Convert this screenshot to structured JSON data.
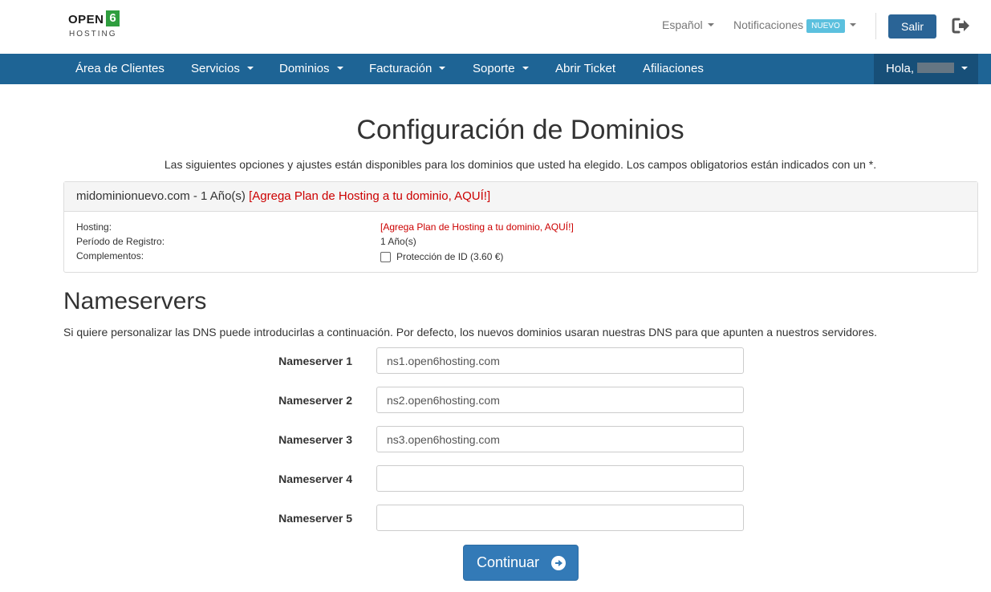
{
  "header": {
    "logo": {
      "top": "OPEN",
      "digit": "6",
      "bottom": "HOSTING"
    },
    "language": "Español",
    "notifications": "Notificaciones",
    "notifications_badge": "NUEVO",
    "logout_button": "Salir",
    "logout_icon": "sign-out-icon"
  },
  "nav": {
    "items": [
      {
        "label": "Área de Clientes",
        "dropdown": false
      },
      {
        "label": "Servicios",
        "dropdown": true
      },
      {
        "label": "Dominios",
        "dropdown": true
      },
      {
        "label": "Facturación",
        "dropdown": true
      },
      {
        "label": "Soporte",
        "dropdown": true
      },
      {
        "label": "Abrir Ticket",
        "dropdown": false
      },
      {
        "label": "Afiliaciones",
        "dropdown": false
      }
    ],
    "greeting": "Hola,"
  },
  "main": {
    "title": "Configuración de Dominios",
    "intro": "Las siguientes opciones y ajustes están disponibles para los dominios que usted ha elegido. Los campos obligatorios están indicados con un *.",
    "domain_panel": {
      "heading": "midominionuevo.com - 1 Año(s)",
      "heading_link": "[Agrega Plan de Hosting a tu dominio, AQUÍ!]",
      "rows": {
        "hosting_label": "Hosting:",
        "hosting_value": "[Agrega Plan de Hosting a tu dominio, AQUÍ!]",
        "period_label": "Período de Registro:",
        "period_value": "1 Año(s)",
        "addons_label": "Complementos:",
        "addon_id_protection": "Protección de ID (3.60 €)",
        "addon_checked": false
      }
    },
    "nameservers": {
      "title": "Nameservers",
      "description": "Si quiere personalizar las DNS puede introducirlas a continuación. Por defecto, los nuevos dominios usaran nuestras DNS para que apunten a nuestros servidores.",
      "fields": [
        {
          "label": "Nameserver 1",
          "value": "ns1.open6hosting.com"
        },
        {
          "label": "Nameserver 2",
          "value": "ns2.open6hosting.com"
        },
        {
          "label": "Nameserver 3",
          "value": "ns3.open6hosting.com"
        },
        {
          "label": "Nameserver 4",
          "value": ""
        },
        {
          "label": "Nameserver 5",
          "value": ""
        }
      ]
    },
    "continue_button": "Continuar",
    "continue_icon": "arrow-circle-right-icon"
  },
  "colors": {
    "navbar": "#1e6495",
    "primary": "#337ab7",
    "link_red": "#cc0000",
    "badge": "#5bc0de",
    "logo_green": "#2f9e3f"
  }
}
